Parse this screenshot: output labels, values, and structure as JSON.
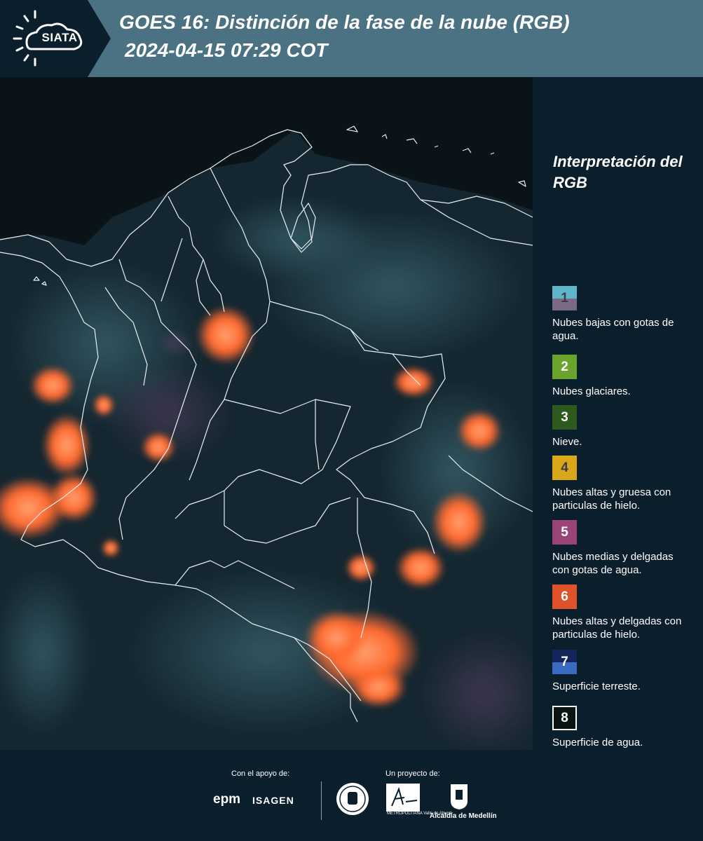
{
  "header": {
    "logo_text": "SIATA",
    "title_line1": "GOES 16: Distinción de la fase de la nube (RGB)",
    "title_line2": "2024-04-15 07:29 COT"
  },
  "legend": {
    "title": "Interpretación del RGB",
    "items": [
      {
        "number": "1",
        "label": "Nubes bajas con gotas de agua.",
        "color_top": "#5fb6c6",
        "color_bottom": "#7a6a87",
        "text_color": "#3a3a4a"
      },
      {
        "number": "2",
        "label": "Nubes glaciares.",
        "color_top": "#6aa42d",
        "color_bottom": "#6aa42d",
        "text_color": "#ffffff"
      },
      {
        "number": "3",
        "label": "Nieve.",
        "color_top": "#2f5a1d",
        "color_bottom": "#2f5a1d",
        "text_color": "#ffffff"
      },
      {
        "number": "4",
        "label": "Nubes altas y gruesa con particulas de hielo.",
        "color_top": "#d8a81a",
        "color_bottom": "#d8a81a",
        "text_color": "#3a3a4a"
      },
      {
        "number": "5",
        "label": "Nubes medias y delgadas con gotas de agua.",
        "color_top": "#9a4579",
        "color_bottom": "#9a4579",
        "text_color": "#ffffff"
      },
      {
        "number": "6",
        "label": "Nubes altas y delgadas con particulas de hielo.",
        "color_top": "#e0522a",
        "color_bottom": "#e0522a",
        "text_color": "#ffffff"
      },
      {
        "number": "7",
        "label": "Superficie terreste.",
        "color_top": "#13255a",
        "color_bottom": "#3a6bc0",
        "text_color": "#ffffff"
      },
      {
        "number": "8",
        "label": "Superficie de agua.",
        "color_top": "#0a1410",
        "color_bottom": "#0a1410",
        "text_color": "#ffffff",
        "border": "#ffffff"
      }
    ]
  },
  "footer": {
    "support_caption": "Con el apoyo de:",
    "project_caption": "Un proyecto de:",
    "epm": "epm",
    "isagen": "ISAGEN",
    "amva": "METROPOLITANA Valle de Aburrá",
    "medellin": "Alcaldía de Medellín"
  },
  "colors": {
    "header_bg": "#4a7282",
    "logo_bg": "#0b1e2c",
    "page_bg": "#0b1e2c",
    "cloud_orange": "#ff7a3a"
  }
}
